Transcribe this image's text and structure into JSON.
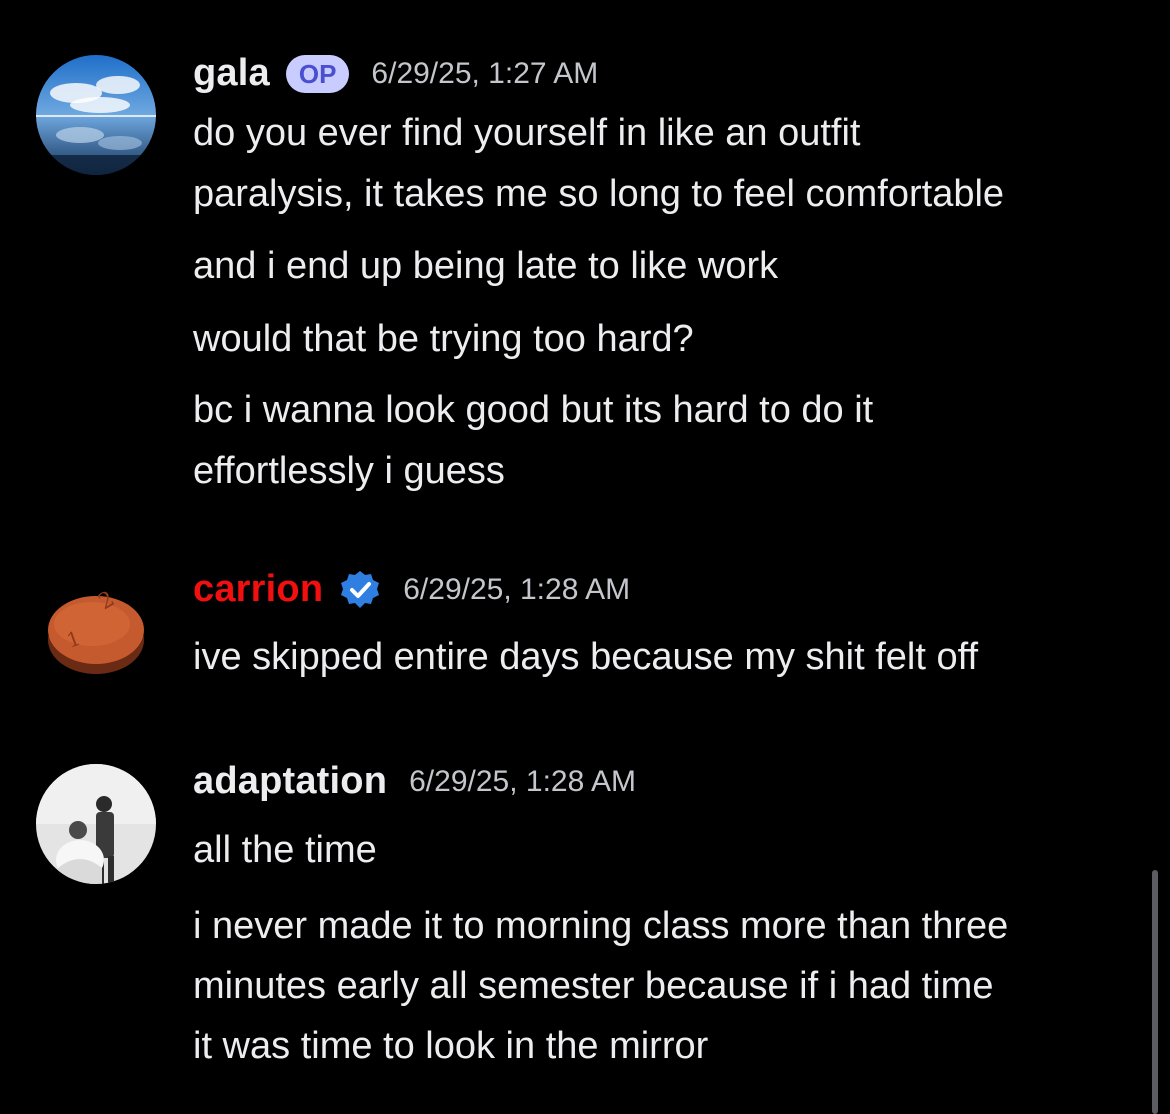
{
  "messages": [
    {
      "username": "gala",
      "username_color": "#ededf0",
      "badge": "OP",
      "timestamp": "6/29/25, 1:27 AM",
      "avatar_icon": "sky-reflection-avatar",
      "lines": [
        "do you ever find yourself in like an outfit",
        "paralysis, it takes me so long to feel comfortable",
        "and i end up being late to like work",
        "would that be trying too hard?",
        "bc i wanna look good but its hard to do it",
        "effortlessly i guess"
      ]
    },
    {
      "username": "carrion",
      "username_color": "#f20f0f",
      "verified_icon": "verified-check-icon",
      "timestamp": "6/29/25, 1:28 AM",
      "avatar_icon": "orange-pill-avatar",
      "lines": [
        "ive skipped entire days because my shit felt off"
      ]
    },
    {
      "username": "adaptation",
      "username_color": "#ededf0",
      "timestamp": "6/29/25, 1:28 AM",
      "avatar_icon": "bw-photo-avatar",
      "lines": [
        "all the time",
        "i never made it to morning class more than three",
        "minutes early all semester because if i had time",
        "it was time to look in the mirror"
      ]
    }
  ],
  "colors": {
    "background": "#000000",
    "text": "#ededf0",
    "timestamp": "#c4c6cc",
    "op_badge_bg": "#c9ccff",
    "op_badge_text": "#4a4fd1",
    "verified": "#2f7fe3"
  }
}
